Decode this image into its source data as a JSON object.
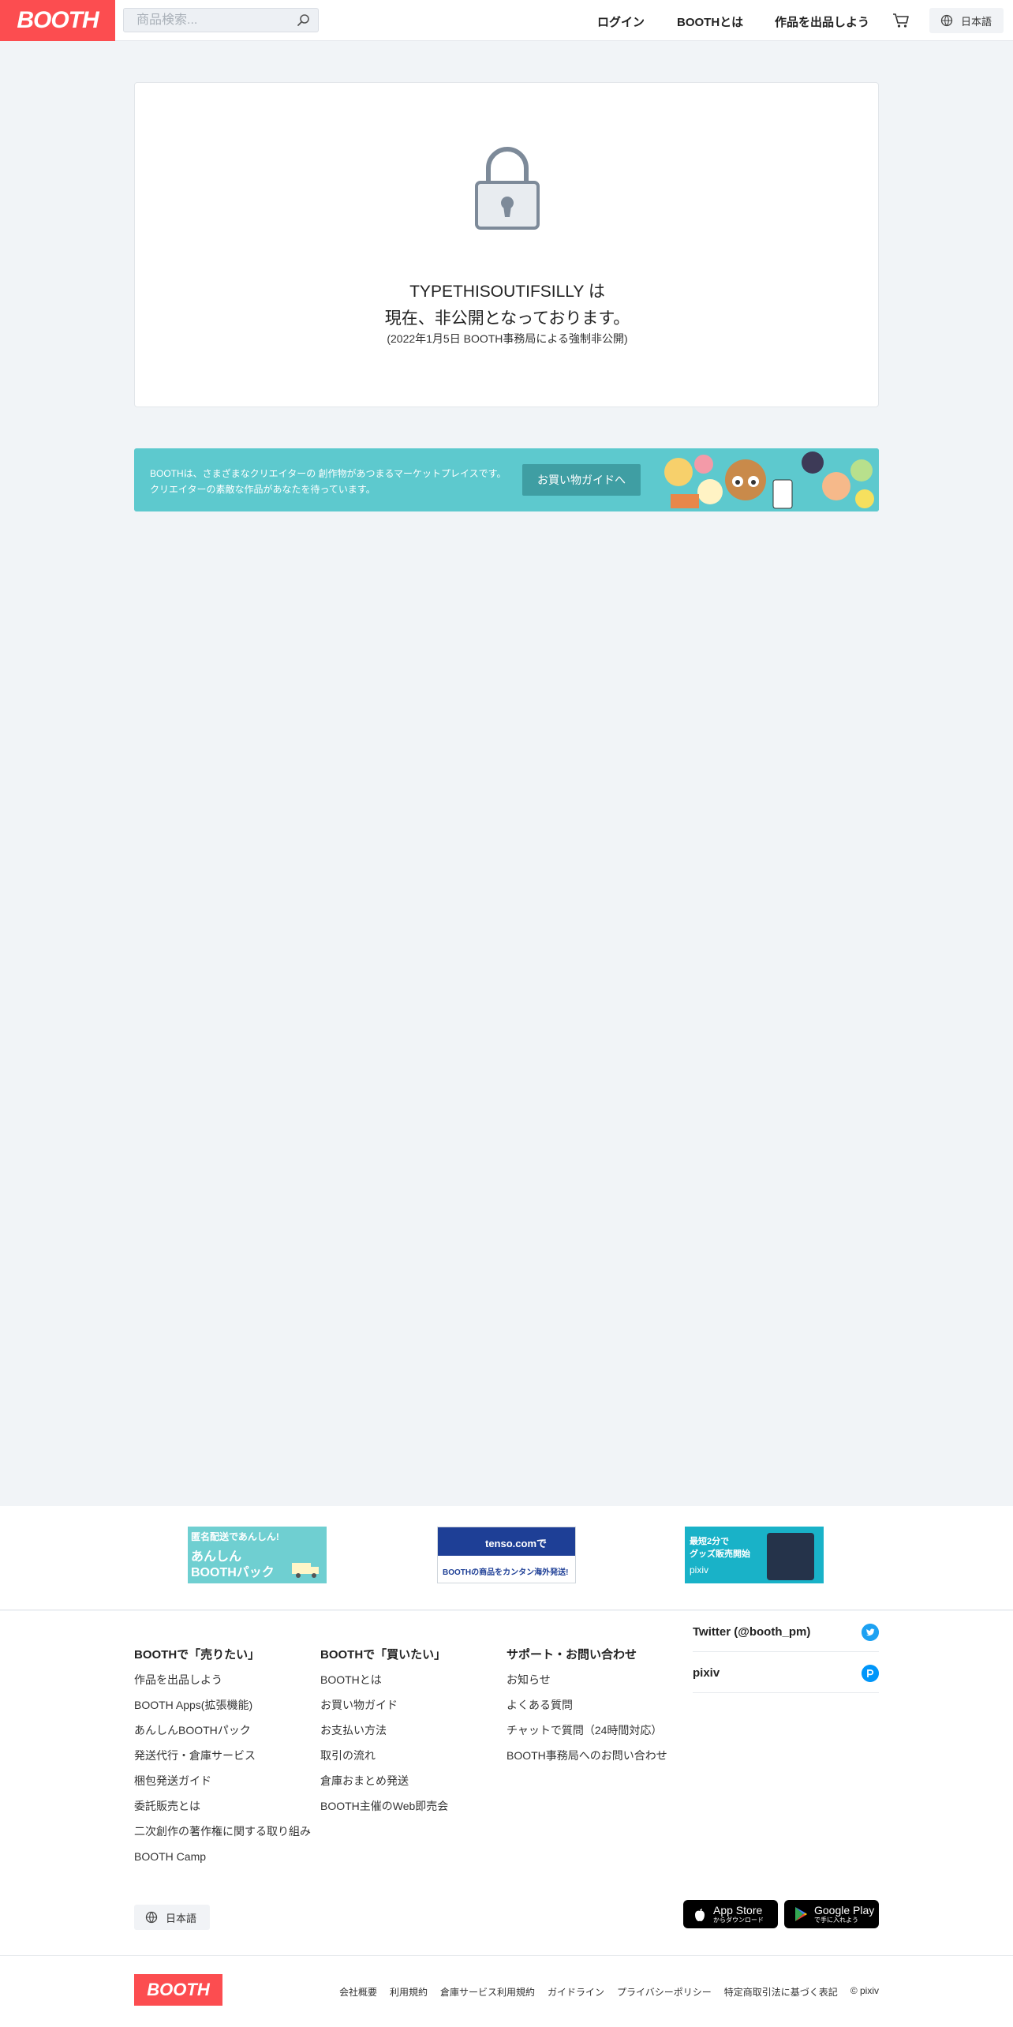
{
  "header": {
    "logo": "BOOTH",
    "search_placeholder": "商品検索...",
    "nav": {
      "login": "ログイン",
      "about": "BOOTHとは",
      "sell": "作品を出品しよう"
    },
    "language": "日本語"
  },
  "private": {
    "shop_name_line": "TYPETHISOUTIFSILLY は",
    "status_line": "現在、非公開となっております。",
    "note": "(2022年1月5日 BOOTH事務局による強制非公開)"
  },
  "banner": {
    "line1": "BOOTHは、さまざまなクリエイターの 創作物があつまるマーケットプレイスです。",
    "line2": "クリエイターの素敵な作品があなたを待っています。",
    "button": "お買い物ガイドへ"
  },
  "ads": {
    "ad1": {
      "top": "匿名配送であんしん!",
      "mid": "あんしん",
      "bottom": "BOOTHパック"
    },
    "ad2": {
      "brand": "tenso.comで",
      "bottom": "BOOTHの商品をカンタン海外発送!"
    },
    "ad3": {
      "line1": "最短2分で",
      "line2": "グッズ販売開始",
      "brand": "pixiv"
    }
  },
  "footer": {
    "sell": {
      "heading": "BOOTHで「売りたい」",
      "links": [
        "作品を出品しよう",
        "BOOTH Apps(拡張機能)",
        "あんしんBOOTHパック",
        "発送代行・倉庫サービス",
        "梱包発送ガイド",
        "委託販売とは",
        "二次創作の著作権に関する取り組み",
        "BOOTH Camp"
      ]
    },
    "buy": {
      "heading": "BOOTHで「買いたい」",
      "links": [
        "BOOTHとは",
        "お買い物ガイド",
        "お支払い方法",
        "取引の流れ",
        "倉庫おまとめ発送",
        "BOOTH主催のWeb即売会"
      ]
    },
    "support": {
      "heading": "サポート・お問い合わせ",
      "links": [
        "お知らせ",
        "よくある質問",
        "チャットで質問（24時間対応）",
        "BOOTH事務局へのお問い合わせ"
      ]
    },
    "social": {
      "twitter": "Twitter (@booth_pm)",
      "pixiv": "pixiv"
    },
    "language": "日本語",
    "app_store": {
      "big": "App Store",
      "small": "からダウンロード"
    },
    "google_play": {
      "big": "Google Play",
      "small": "で手に入れよう"
    },
    "logo": "BOOTH",
    "bottom_links": [
      "会社概要",
      "利用規約",
      "倉庫サービス利用規約",
      "ガイドライン",
      "プライバシーポリシー",
      "特定商取引法に基づく表記",
      "© pixiv"
    ]
  },
  "colors": {
    "brand": "#fc4d50",
    "banner": "#5dc9ce",
    "twitter": "#1da1f2",
    "pixiv": "#0096fa"
  }
}
